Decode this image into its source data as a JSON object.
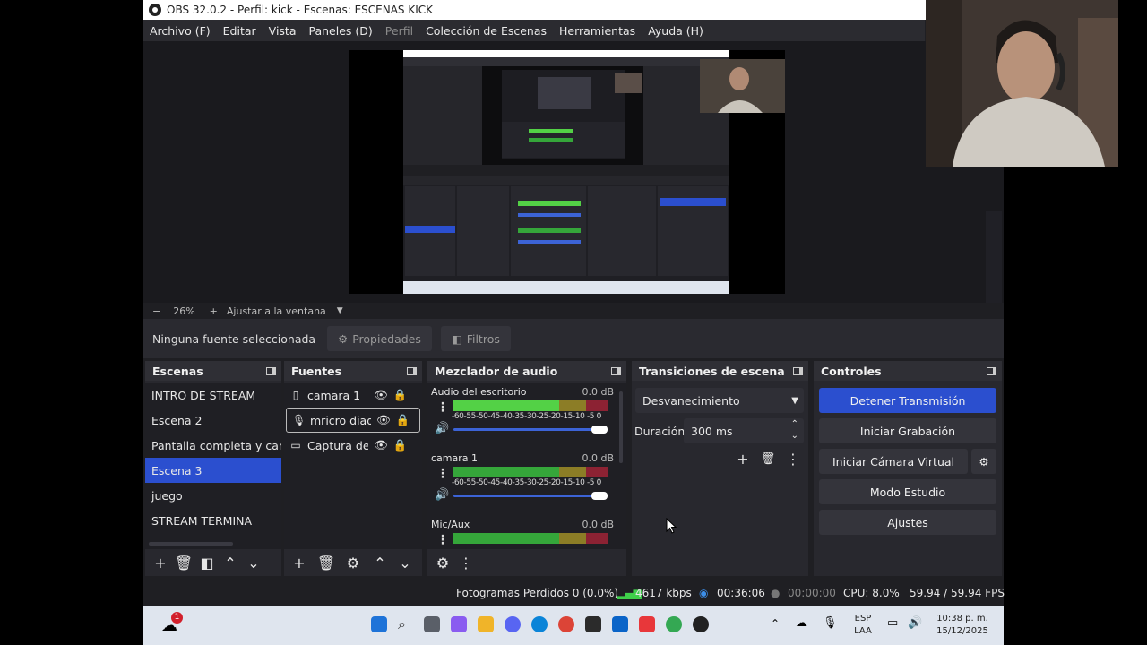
{
  "window": {
    "title": "OBS 32.0.2 - Perfil: kick - Escenas: ESCENAS KICK",
    "minimize": "—"
  },
  "menu": [
    "Archivo (F)",
    "Editar",
    "Vista",
    "Paneles (D)",
    "Perfil",
    "Colección de Escenas",
    "Herramientas",
    "Ayuda (H)"
  ],
  "zoom": {
    "minus": "−",
    "level": "26%",
    "plus": "+",
    "fit": "Ajustar a la ventana",
    "caret": "▼"
  },
  "source_bar": {
    "none_selected": "Ninguna fuente seleccionada",
    "properties": "Propiedades",
    "filters": "Filtros"
  },
  "docks": {
    "scenes": {
      "title": "Escenas",
      "items": [
        "INTRO DE STREAM",
        "Escena 2",
        "Pantalla completa y camara",
        "Escena 3",
        "juego",
        "STREAM TERMINA"
      ],
      "active_index": 3
    },
    "sources": {
      "title": "Fuentes",
      "items": [
        {
          "name": "camara 1",
          "icon": "file-icon"
        },
        {
          "name": "mricro diadema",
          "icon": "mic-icon"
        },
        {
          "name": "Captura de pantalla",
          "icon": "monitor-icon"
        }
      ]
    },
    "mixer": {
      "title": "Mezclador de audio",
      "channels": [
        {
          "name": "Audio del escritorio",
          "db": "0.0 dB",
          "level": 0.88
        },
        {
          "name": "camara 1",
          "db": "0.0 dB",
          "level": 0
        },
        {
          "name": "Mic/Aux",
          "db": "0.0 dB",
          "level": 0
        }
      ],
      "ticks": "-60-55-50-45-40-35-30-25-20-15-10 -5  0"
    },
    "transitions": {
      "title": "Transiciones de escena",
      "type": "Desvanecimiento",
      "duration_label": "Duración",
      "duration": "300 ms"
    },
    "controls": {
      "title": "Controles",
      "stop_stream": "Detener Transmisión",
      "start_recording": "Iniciar Grabación",
      "virtual_cam": "Iniciar Cámara Virtual",
      "studio_mode": "Modo Estudio",
      "settings": "Ajustes"
    }
  },
  "status": {
    "dropped": "Fotogramas Perdidos 0 (0.0%)",
    "bitrate": "4617 kbps",
    "stream_time": "00:36:06",
    "rec_time": "00:00:00",
    "cpu": "CPU: 8.0%",
    "fps": "59.94 / 59.94 FPS"
  },
  "taskbar": {
    "notification_badge": "1",
    "lang_top": "ESP",
    "lang_bottom": "LAA",
    "time": "10:38 p. m.",
    "date": "15/12/2025"
  },
  "colors": {
    "accent": "#2b4fcf",
    "panel": "#28282e",
    "window": "#1f1f23"
  }
}
